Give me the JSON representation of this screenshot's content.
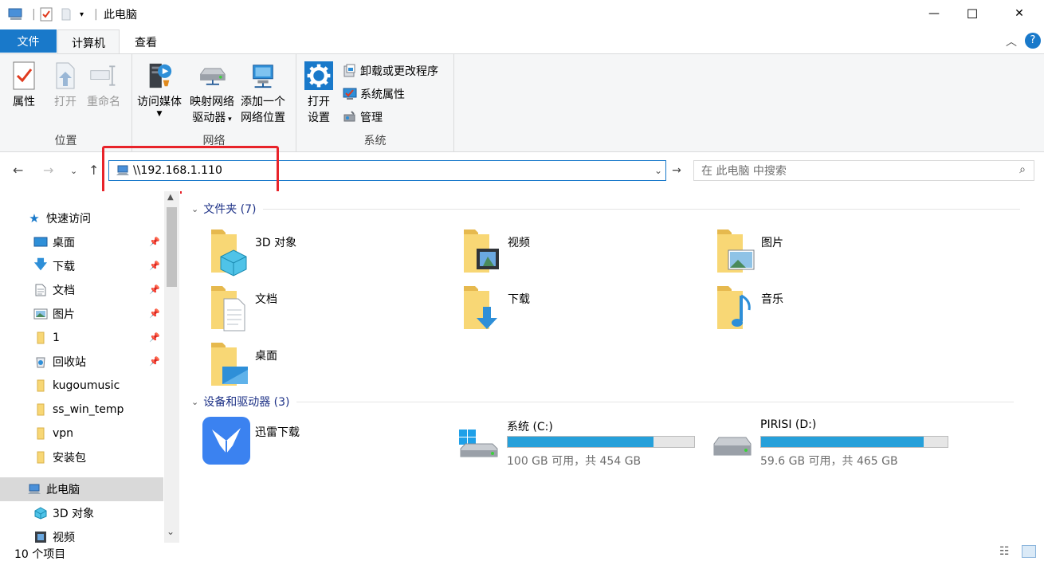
{
  "window": {
    "title": "此电脑",
    "minimize": "—",
    "maximize": "☐",
    "close": "✕"
  },
  "ribbon_tabs": {
    "file": "文件",
    "computer": "计算机",
    "view": "查看"
  },
  "ribbon": {
    "location_group": "位置",
    "properties": "属性",
    "open": "打开",
    "rename": "重命名",
    "network_group": "网络",
    "access_media": "访问媒体",
    "map_drive_l1": "映射网络",
    "map_drive_l2": "驱动器",
    "add_location_l1": "添加一个",
    "add_location_l2": "网络位置",
    "system_group": "系统",
    "open_settings_l1": "打开",
    "open_settings_l2": "设置",
    "uninstall": "卸载或更改程序",
    "system_props": "系统属性",
    "manage": "管理"
  },
  "address": {
    "path": "\\\\192.168.1.110",
    "search_placeholder": "在 此电脑 中搜索"
  },
  "nav": {
    "quick_access": "快速访问",
    "items": [
      {
        "label": "桌面",
        "pinned": true
      },
      {
        "label": "下载",
        "pinned": true
      },
      {
        "label": "文档",
        "pinned": true
      },
      {
        "label": "图片",
        "pinned": true
      },
      {
        "label": "1",
        "pinned": true
      },
      {
        "label": "回收站",
        "pinned": true
      },
      {
        "label": "kugoumusic",
        "pinned": false
      },
      {
        "label": "ss_win_temp",
        "pinned": false
      },
      {
        "label": "vpn",
        "pinned": false
      },
      {
        "label": "安装包",
        "pinned": false
      }
    ],
    "this_pc": "此电脑",
    "pc_items": [
      "3D 对象",
      "视频"
    ]
  },
  "content": {
    "folders_header": "文件夹 (7)",
    "folders": [
      "3D 对象",
      "视频",
      "图片",
      "文档",
      "下载",
      "音乐",
      "桌面"
    ],
    "devices_header": "设备和驱动器 (3)",
    "app_device": "迅雷下载",
    "drives": [
      {
        "name": "系统 (C:)",
        "space": "100 GB 可用，共 454 GB",
        "used_fraction": 0.78
      },
      {
        "name": "PIRISI (D:)",
        "space": "59.6 GB 可用，共 465 GB",
        "used_fraction": 0.87
      }
    ]
  },
  "status": {
    "count": "10 个项目"
  },
  "colors": {
    "accent": "#1979ca",
    "drive_fill": "#26a0da",
    "folder": "#f8d775",
    "highlight": "#e8232a"
  }
}
